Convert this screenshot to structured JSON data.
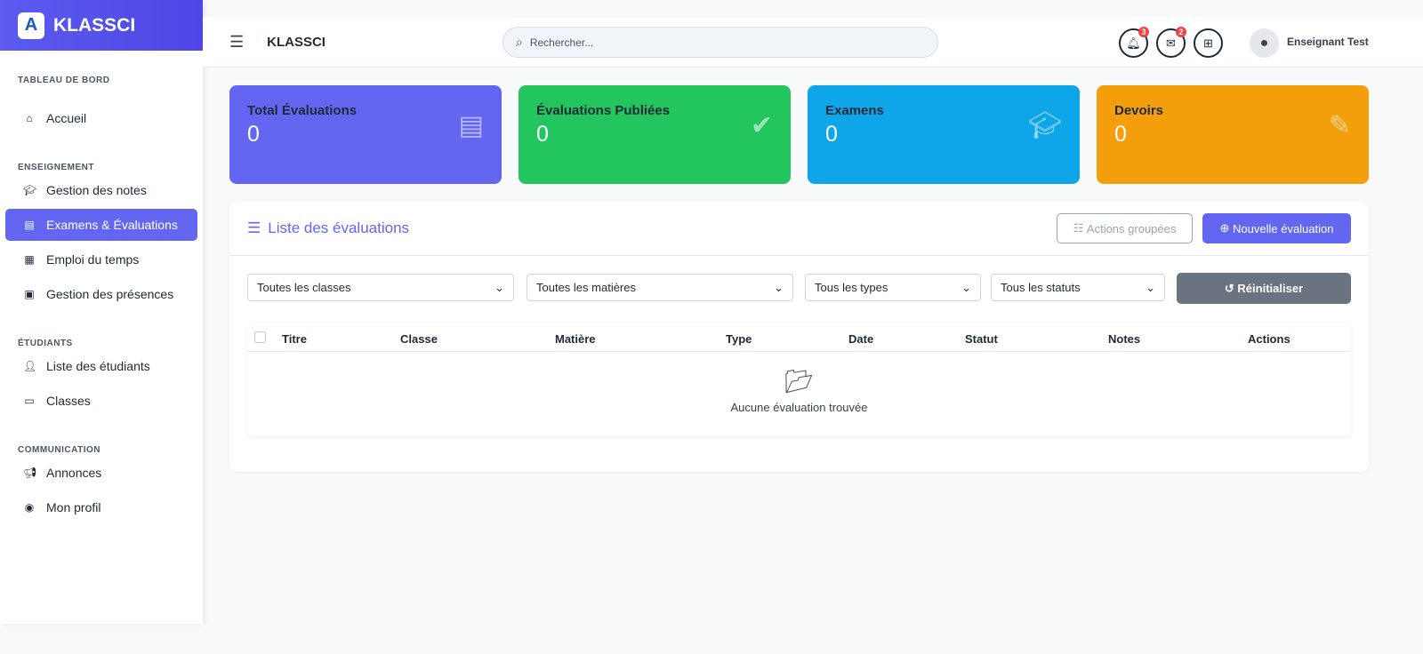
{
  "app": {
    "name": "KLASSCI",
    "logo_letter": "A"
  },
  "sidebar": {
    "sections": [
      {
        "title": "TABLEAU DE BORD",
        "items": [
          {
            "label": "Accueil",
            "icon": "home-icon"
          }
        ]
      },
      {
        "title": "ENSEIGNEMENT",
        "items": [
          {
            "label": "Gestion des notes",
            "icon": "graduation-cap-icon"
          },
          {
            "label": "Examens & Évaluations",
            "icon": "file-icon",
            "active": true
          },
          {
            "label": "Emploi du temps",
            "icon": "calendar-icon"
          },
          {
            "label": "Gestion des présences",
            "icon": "clipboard-check-icon"
          }
        ]
      },
      {
        "title": "ÉTUDIANTS",
        "items": [
          {
            "label": "Liste des étudiants",
            "icon": "user-graduate-icon"
          },
          {
            "label": "Classes",
            "icon": "laptop-icon"
          }
        ]
      },
      {
        "title": "COMMUNICATION",
        "items": [
          {
            "label": "Annonces",
            "icon": "megaphone-icon"
          },
          {
            "label": "Mon profil",
            "icon": "user-circle-icon"
          }
        ]
      }
    ]
  },
  "topbar": {
    "title": "KLASSCI",
    "search_placeholder": "Rechercher...",
    "notifications": "3",
    "messages": "2",
    "user": "Enseignant Test"
  },
  "stats": [
    {
      "label": "Total Évaluations",
      "value": "0",
      "color": "#6366f1"
    },
    {
      "label": "Évaluations Publiées",
      "value": "0",
      "color": "#22c55e"
    },
    {
      "label": "Examens",
      "value": "0",
      "color": "#0ea5e9"
    },
    {
      "label": "Devoirs",
      "value": "0",
      "color": "#f59e0b"
    }
  ],
  "panel": {
    "title": "Liste des évaluations",
    "bulk": "Actions groupées",
    "new": "Nouvelle évaluation",
    "filters": [
      "Toutes les classes",
      "Toutes les matières",
      "Tous les types",
      "Tous les statuts"
    ],
    "reset": "Réinitialiser",
    "columns": [
      "Titre",
      "Classe",
      "Matière",
      "Type",
      "Date",
      "Statut",
      "Notes",
      "Actions"
    ],
    "empty": "Aucune évaluation trouvée"
  }
}
